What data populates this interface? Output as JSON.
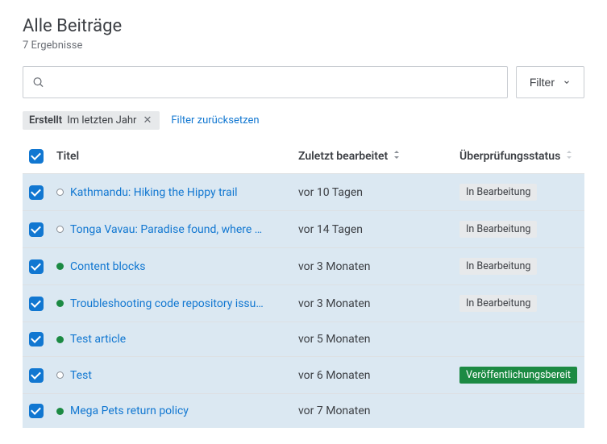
{
  "header": {
    "title": "Alle Beiträge",
    "result_count": "7 Ergebnisse"
  },
  "search": {
    "placeholder": ""
  },
  "filter_button": {
    "label": "Filter"
  },
  "active_filter": {
    "label": "Erstellt",
    "value": "Im letzten Jahr"
  },
  "reset_filter": "Filter zurücksetzen",
  "columns": {
    "title": "Titel",
    "last_edited": "Zuletzt bearbeitet",
    "review_status": "Überprüfungsstatus"
  },
  "status_labels": {
    "in_progress": "In Bearbeitung",
    "ready_publish": "Veröffentlichungsbereit"
  },
  "rows": [
    {
      "title": "Kathmandu: Hiking the Hippy trail",
      "edited": "vor 10 Tagen",
      "dot": "open",
      "status": "in_progress"
    },
    {
      "title": "Tonga Vavau: Paradise found, where …",
      "edited": "vor 14 Tagen",
      "dot": "open",
      "status": "in_progress"
    },
    {
      "title": "Content blocks",
      "edited": "vor 3 Monaten",
      "dot": "green",
      "status": "in_progress"
    },
    {
      "title": "Troubleshooting code repository issu…",
      "edited": "vor 3 Monaten",
      "dot": "green",
      "status": "in_progress"
    },
    {
      "title": "Test article",
      "edited": "vor 5 Monaten",
      "dot": "green",
      "status": null
    },
    {
      "title": "Test",
      "edited": "vor 6 Monaten",
      "dot": "open",
      "status": "ready_publish"
    },
    {
      "title": "Mega Pets return policy",
      "edited": "vor 7 Monaten",
      "dot": "green",
      "status": null
    }
  ]
}
